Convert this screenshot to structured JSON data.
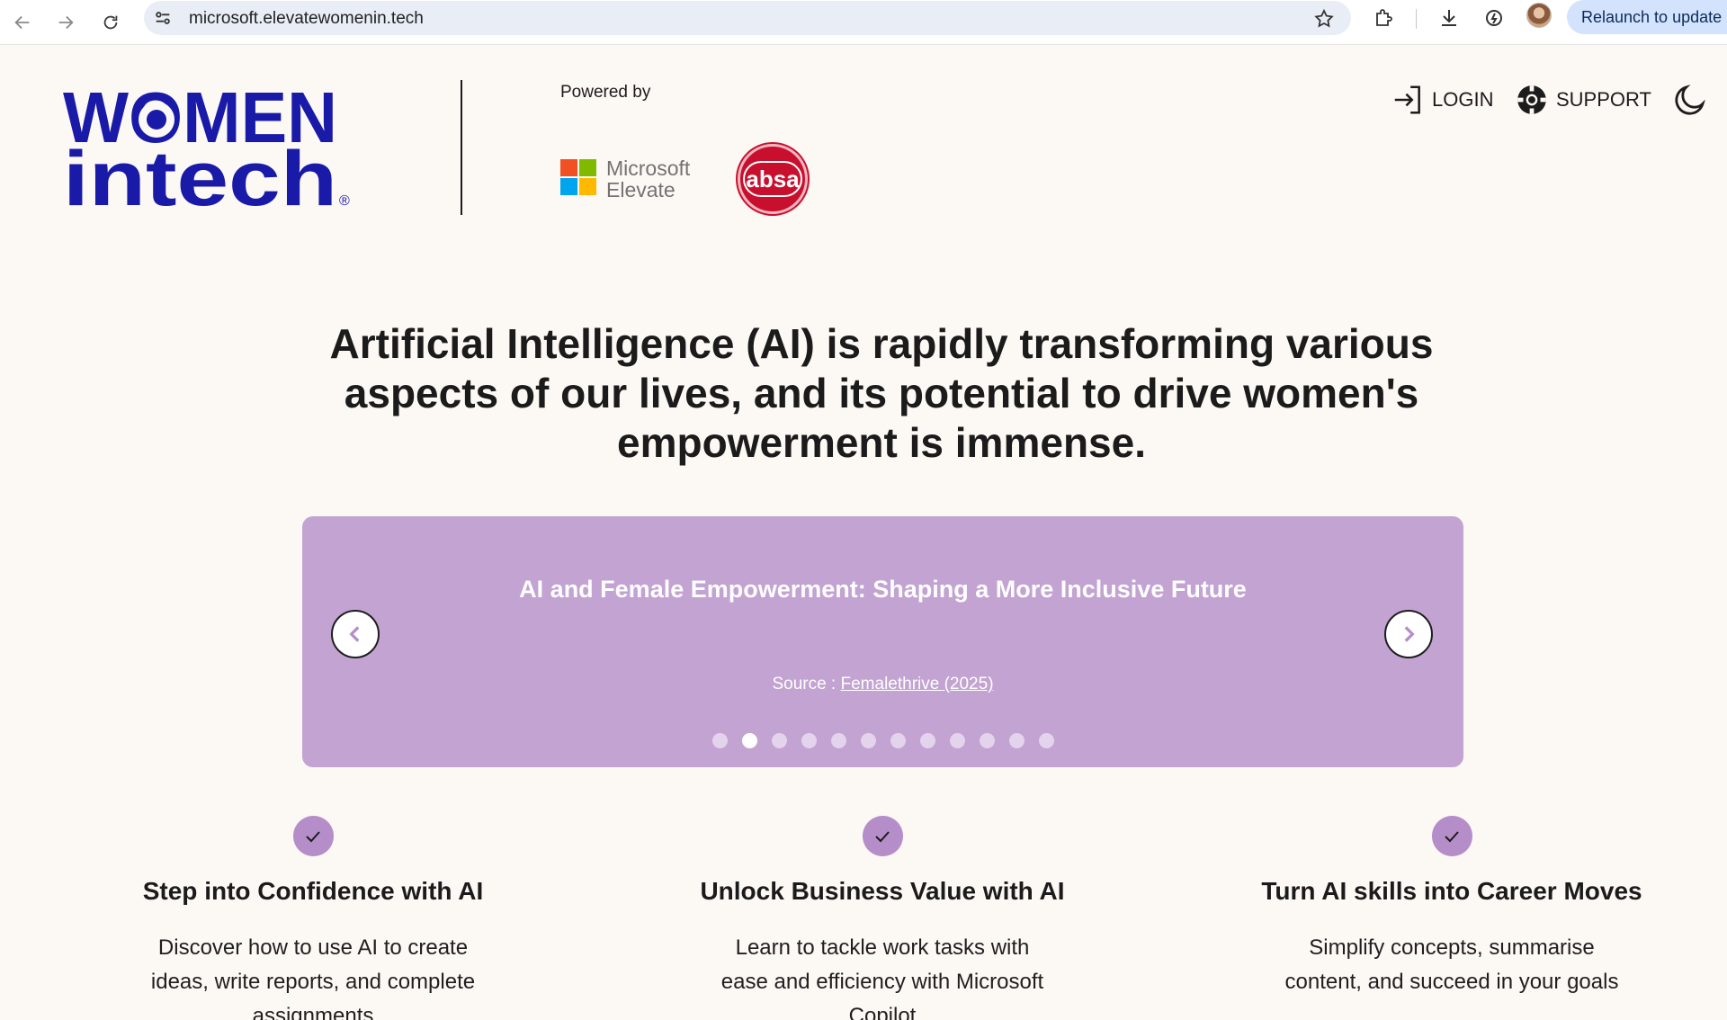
{
  "browser": {
    "url": "microsoft.elevatewomenin.tech",
    "relaunch_label": "Relaunch to update"
  },
  "header": {
    "powered_by": "Powered by",
    "microsoft_line1": "Microsoft",
    "microsoft_line2": "Elevate",
    "absa": "absa",
    "login": "LOGIN",
    "support": "SUPPORT"
  },
  "brand": {
    "logo_line1": "WOMEN",
    "logo_line2": "in tech",
    "logo_color": "#1a1aa8",
    "absa_color": "#c8102e",
    "accent_purple": "#c2a3d2"
  },
  "hero": {
    "heading": "Artificial Intelligence (AI) is rapidly transforming various aspects of our lives, and its potential to drive women's empowerment is immense."
  },
  "carousel": {
    "title": "AI and Female Empowerment: Shaping a More Inclusive Future",
    "source_prefix": "Source : ",
    "source_link": "Femalethrive (2025)",
    "dot_count": 12,
    "active_dot_index": 1
  },
  "features": [
    {
      "title": "Step into Confidence with AI",
      "description": "Discover how to use AI to create ideas, write reports, and complete assignments"
    },
    {
      "title": "Unlock Business Value with AI",
      "description": "Learn to tackle work tasks with ease and efficiency with Microsoft Copilot"
    },
    {
      "title": "Turn AI skills into Career Moves",
      "description": "Simplify concepts, summarise content, and succeed in your goals"
    }
  ]
}
